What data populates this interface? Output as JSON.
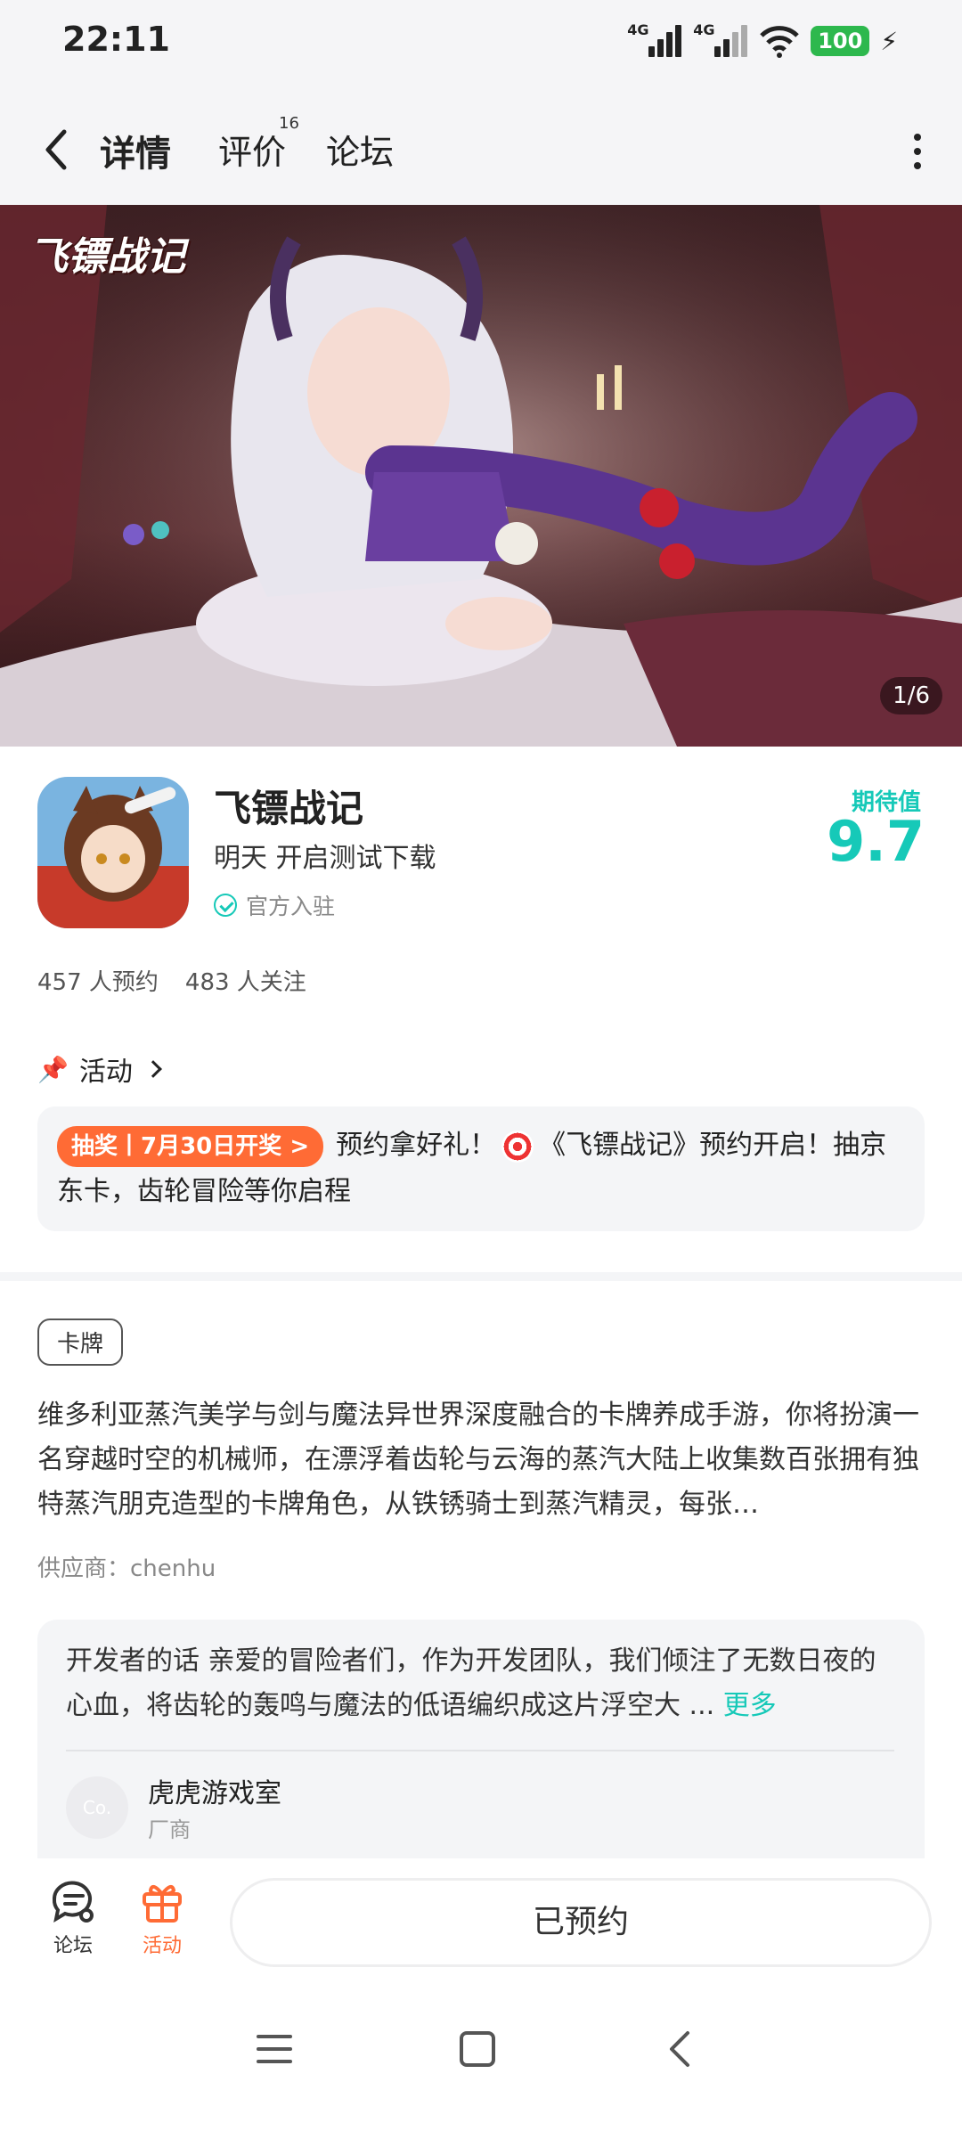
{
  "status_bar": {
    "time": "22:11",
    "net1": "4G",
    "net2": "4G",
    "battery": "100",
    "icons": [
      "signal-icon",
      "signal-icon",
      "wifi-icon",
      "battery-icon",
      "charging-icon"
    ]
  },
  "nav": {
    "tabs": [
      {
        "label": "详情",
        "active": true
      },
      {
        "label": "评价",
        "count": "16"
      },
      {
        "label": "论坛"
      }
    ]
  },
  "banner": {
    "logo_text": "飞镖战记",
    "counter": "1/6"
  },
  "app": {
    "name": "飞镖战记",
    "subtitle": "明天 开启测试下载",
    "official": "官方入驻",
    "expect_label": "期待值",
    "expect_score": "9.7",
    "reservations": "457 人预约",
    "followers": "483 人关注"
  },
  "activity": {
    "title": "活动",
    "badge": "抽奖丨7月30日开奖 >",
    "text_part1": "预约拿好礼！",
    "text_part2": "《飞镖战记》预约开启！抽京东卡，齿轮冒险等你启程"
  },
  "description": {
    "tag": "卡牌",
    "text": "维多利亚蒸汽美学与剑与魔法异世界深度融合的卡牌养成手游，你将扮演一名穿越时空的机械师，在漂浮着齿轮与云海的蒸汽大陆上收集数百张拥有独特蒸汽朋克造型的卡牌角色，从铁锈骑士到蒸汽精灵，每张…",
    "supplier": "供应商：chenhu"
  },
  "developer": {
    "text": "开发者的话  亲爱的冒险者们，作为开发团队，我们倾注了无数日夜的心血，将齿轮的轰鸣与魔法的低语编织成这片浮空大 ... ",
    "more": "更多",
    "avatar_text": "Co.",
    "name": "虎虎游戏室",
    "role": "厂商"
  },
  "bottom_bar": {
    "forum": "论坛",
    "activity": "活动",
    "reserve": "已预约"
  },
  "colors": {
    "accent": "#16c9b8",
    "orange": "#ff6b35"
  }
}
